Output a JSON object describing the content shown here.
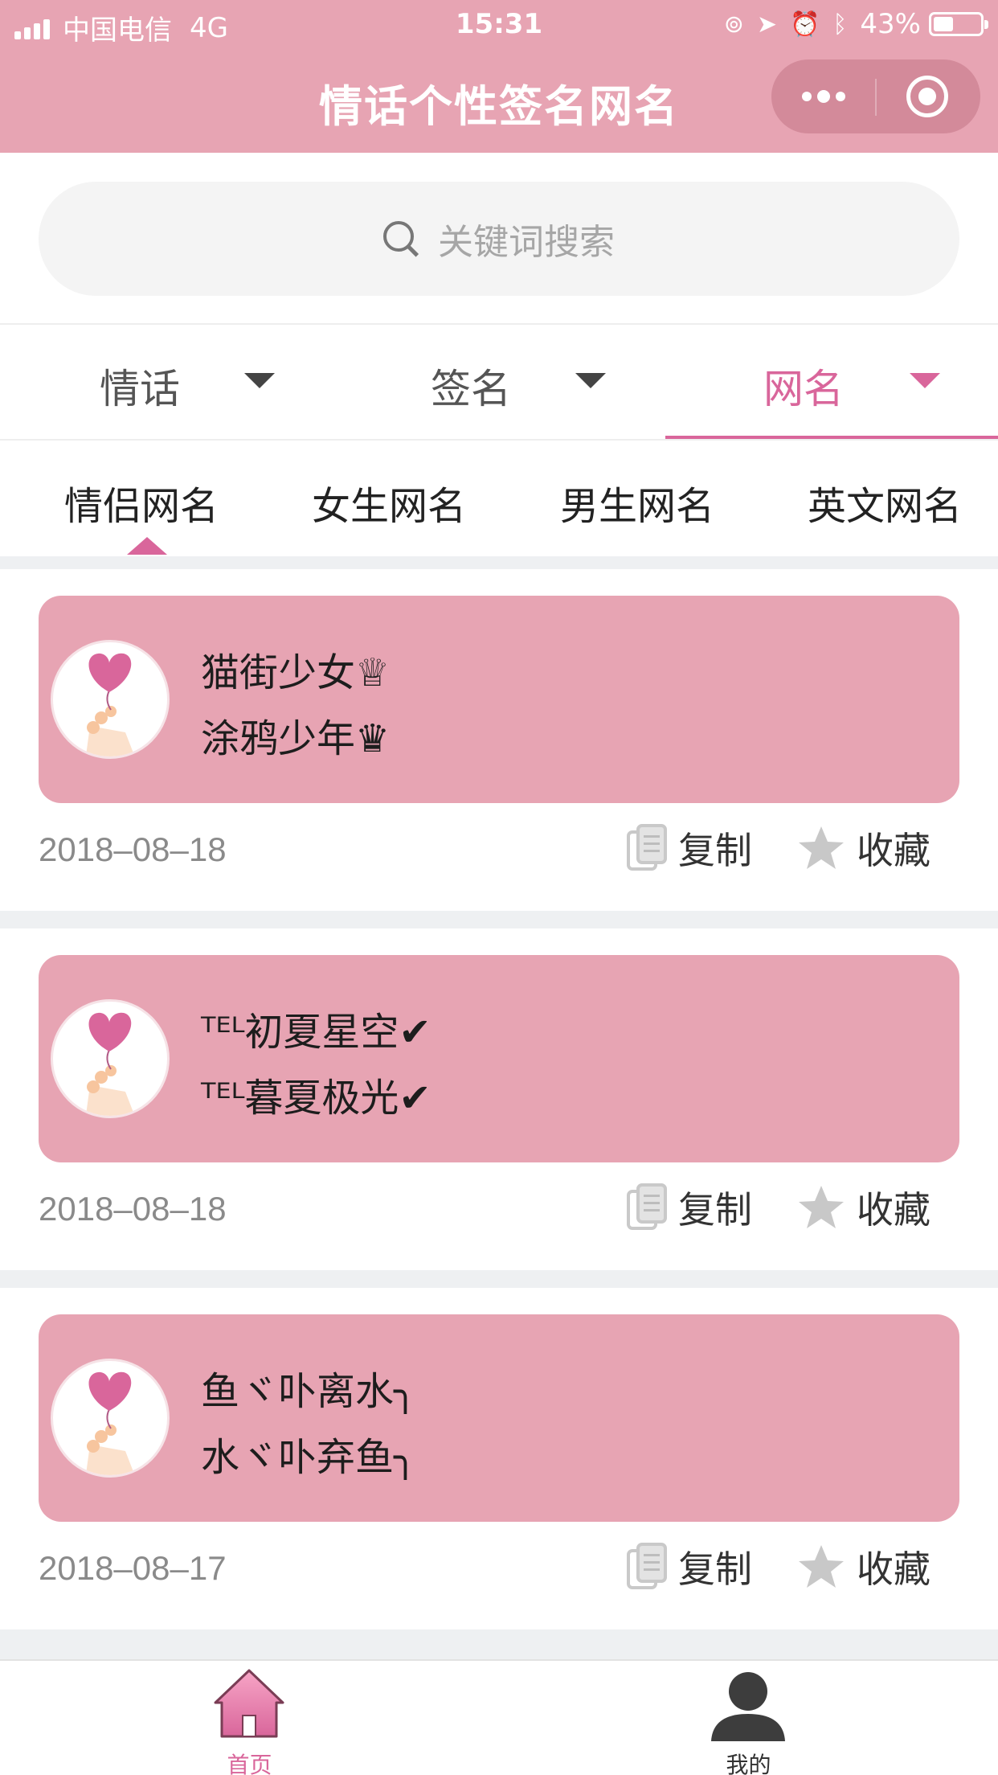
{
  "status_bar": {
    "carrier": "中国电信",
    "network": "4G",
    "time": "15:31",
    "battery": "43%",
    "battery_level": 0.43
  },
  "header": {
    "title": "情话个性签名网名",
    "more_icon": "more-dots-icon",
    "close_icon": "target-circle-icon"
  },
  "search": {
    "placeholder": "关键词搜索",
    "icon": "search-icon"
  },
  "filters": [
    {
      "label": "情话",
      "active": false
    },
    {
      "label": "签名",
      "active": false
    },
    {
      "label": "网名",
      "active": true
    }
  ],
  "categories": [
    {
      "label": "情侣网名",
      "active": true
    },
    {
      "label": "女生网名",
      "active": false
    },
    {
      "label": "男生网名",
      "active": false
    },
    {
      "label": "英文网名",
      "active": false
    }
  ],
  "actions": {
    "copy_label": "复制",
    "favorite_label": "收藏"
  },
  "posts": [
    {
      "line1": "猫街少女♕",
      "line2": "涂鸦少年♛",
      "date": "2018–08–18"
    },
    {
      "line1": "ᵀᴱᴸ初夏星空✔",
      "line2": "ᵀᴱᴸ暮夏极光✔",
      "date": "2018–08–18"
    },
    {
      "line1": "鱼ヾ卟离水╮",
      "line2": "水ヾ卟弃鱼╮",
      "date": "2018–08–17"
    }
  ],
  "tabbar": {
    "home_label": "首页",
    "mine_label": "我的"
  },
  "colors": {
    "brand_pink": "#e7a4b3",
    "accent": "#d9669b",
    "page_gap": "#eef0f2"
  }
}
